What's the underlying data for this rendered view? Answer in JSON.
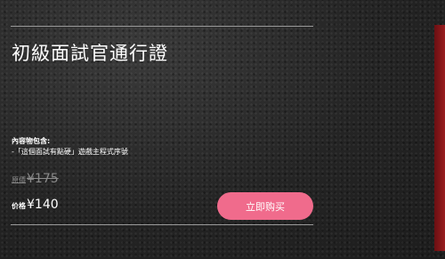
{
  "pass": {
    "title": "初級面試官通行證",
    "contents_heading": "內容物包含:",
    "contents_items": [
      "-「這個面試有點硬」遊戲主程式序號"
    ],
    "original_price_label": "原價",
    "original_price": "¥175",
    "price_label": "价格",
    "price": "¥140",
    "buy_label": "立即购买"
  },
  "colors": {
    "buy_button": "#f06b8c",
    "accent_strip": "#9a1d1f",
    "background": "#262626"
  }
}
